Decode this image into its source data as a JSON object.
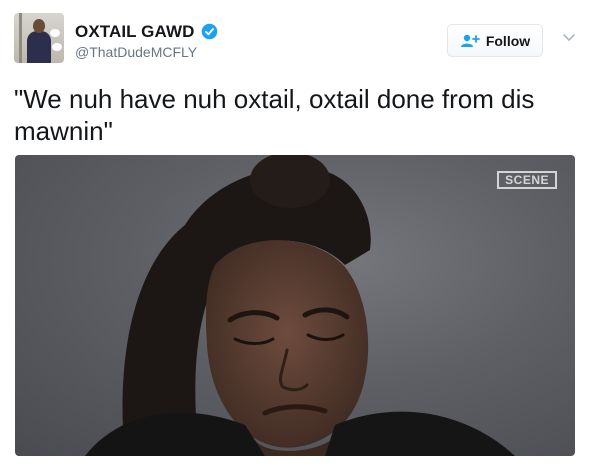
{
  "tweet": {
    "author": {
      "display_name": "OXTAIL GAWD",
      "handle": "@ThatDudeMCFLY",
      "verified": true
    },
    "follow_button": {
      "label": "Follow",
      "icon": "add-user-icon"
    },
    "menu_caret": {
      "icon": "chevron-down-icon"
    },
    "text": "\"We nuh have nuh oxtail, oxtail done from dis mawnin\"",
    "media": {
      "watermark": "SCENE"
    }
  },
  "colors": {
    "verified_blue": "#1da1f2",
    "follow_icon_blue": "#1da1f2",
    "text_primary": "#14171a",
    "text_secondary": "#657786"
  }
}
